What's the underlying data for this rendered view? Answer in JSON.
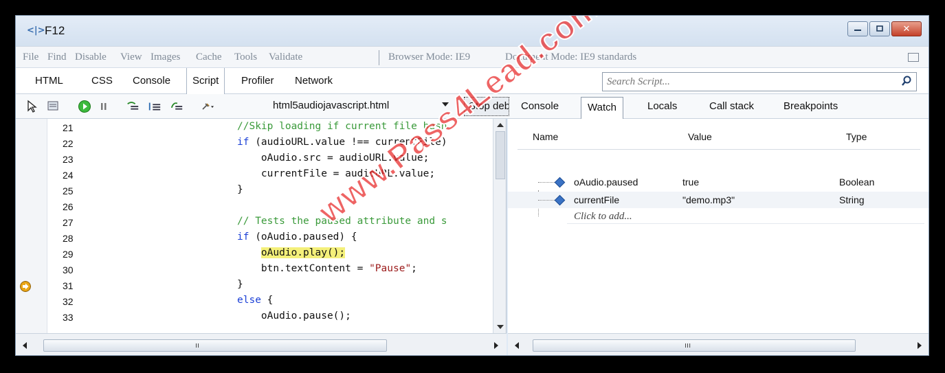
{
  "window": {
    "title": "F12"
  },
  "menu": {
    "items": [
      "File",
      "Find",
      "Disable",
      "View",
      "Images",
      "Cache",
      "Tools",
      "Validate"
    ],
    "browser_mode": "Browser Mode: IE9",
    "document_mode": "Document Mode: IE9 standards"
  },
  "tabs": [
    "HTML",
    "CSS",
    "Console",
    "Script",
    "Profiler",
    "Network"
  ],
  "active_tab": "Script",
  "search": {
    "placeholder": "Search Script..."
  },
  "toolbar": {
    "file": "html5audiojavascript.html",
    "stop_button": "Stop debugging"
  },
  "right_tabs": [
    "Console",
    "Watch",
    "Locals",
    "Call stack",
    "Breakpoints"
  ],
  "active_right_tab": "Watch",
  "code": {
    "line_numbers": [
      "21",
      "22",
      "23",
      "24",
      "25",
      "26",
      "27",
      "28",
      "29",
      "30",
      "31",
      "32",
      "33"
    ],
    "current_line": "29",
    "lines": [
      "//Skip loading if current file hasn",
      "if (audioURL.value !== currentFile)",
      "    oAudio.src = audioURL.value;",
      "    currentFile = audioURL.value;",
      "}",
      "",
      "// Tests the paused attribute and s",
      "if (oAudio.paused) {",
      "    oAudio.play();",
      "    btn.textContent = \"Pause\";",
      "}",
      "else {",
      "    oAudio.pause();"
    ]
  },
  "watch": {
    "headers": {
      "name": "Name",
      "value": "Value",
      "type": "Type"
    },
    "rows": [
      {
        "name": "oAudio.paused",
        "value": "true",
        "type": "Boolean"
      },
      {
        "name": "currentFile",
        "value": "\"demo.mp3\"",
        "type": "String"
      }
    ],
    "add_placeholder": "Click to add..."
  },
  "watermark": "www.Pass4Lead.com",
  "colors": {
    "comment": "#3a9a3a",
    "keyword": "#1a3fd6",
    "string": "#9b1a1a",
    "highlight": "#f4f07a",
    "watermark": "#e82828"
  }
}
